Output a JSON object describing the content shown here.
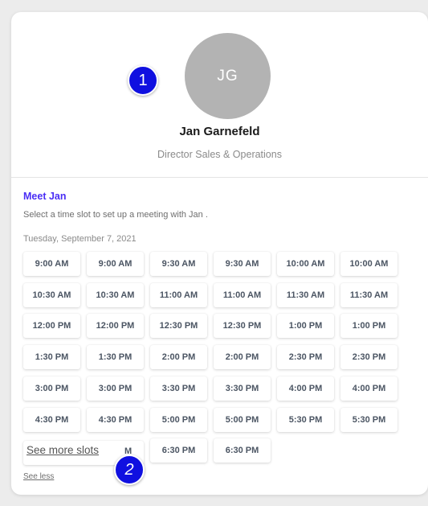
{
  "profile": {
    "initials": "JG",
    "name": "Jan Garnefeld",
    "title": "Director Sales & Operations"
  },
  "booking": {
    "heading": "Meet Jan",
    "instruction": "Select a time slot to set up a meeting with Jan .",
    "date": "Tuesday, September 7, 2021",
    "slots": [
      "9:00 AM",
      "9:00 AM",
      "9:30 AM",
      "9:30 AM",
      "10:00 AM",
      "10:00 AM",
      "10:30 AM",
      "10:30 AM",
      "11:00 AM",
      "11:00 AM",
      "11:30 AM",
      "11:30 AM",
      "12:00 PM",
      "12:00 PM",
      "12:30 PM",
      "12:30 PM",
      "1:00 PM",
      "1:00 PM",
      "1:30 PM",
      "1:30 PM",
      "2:00 PM",
      "2:00 PM",
      "2:30 PM",
      "2:30 PM",
      "3:00 PM",
      "3:00 PM",
      "3:30 PM",
      "3:30 PM",
      "4:00 PM",
      "4:00 PM",
      "4:30 PM",
      "4:30 PM",
      "5:00 PM",
      "5:00 PM",
      "5:30 PM",
      "5:30 PM",
      "6:30 PM",
      "6:30 PM"
    ],
    "partial_slot_text": "M",
    "see_more_label": "See more slots",
    "see_less_label": "See less"
  },
  "annotations": {
    "badge_1": "1",
    "badge_2": "2",
    "badge_color": "#1010e0"
  },
  "colors": {
    "accent": "#4a2ef5",
    "avatar_bg": "#b3b3b3"
  }
}
